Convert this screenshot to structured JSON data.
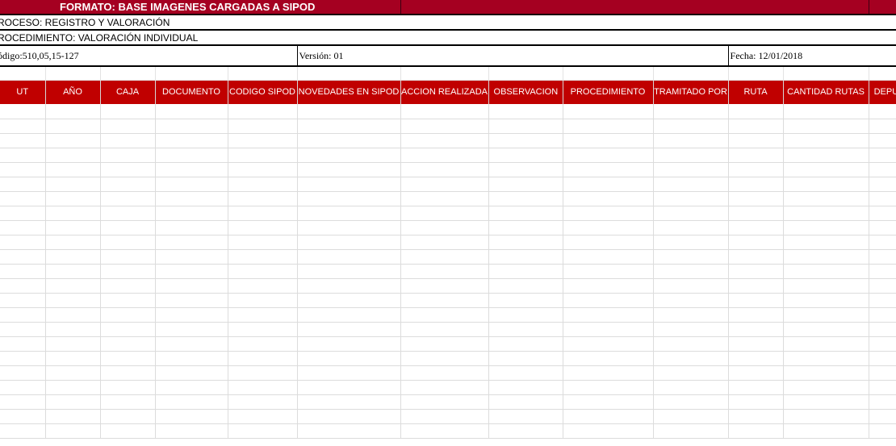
{
  "title": "FORMATO: BASE IMAGENES CARGADAS A SIPOD",
  "info": {
    "proceso": "ROCESO:  REGISTRO Y VALORACIÓN",
    "procedimiento": "ROCEDIMIENTO: VALORACIÓN INDIVIDUAL",
    "codigo": "ódigo:510,05,15-127",
    "version": "Versión: 01",
    "fecha": "Fecha:  12/01/2018"
  },
  "columns": [
    "UT",
    "AÑO",
    "CAJA",
    "DOCUMENTO",
    "CODIGO SIPOD",
    "NOVEDADES EN SIPOD",
    "ACCION REALIZADA",
    "OBSERVACION",
    "PROCEDIMIENTO",
    "TRAMITADO POR",
    "RUTA",
    "CANTIDAD RUTAS",
    "DEPU"
  ],
  "colors": {
    "title_bg": "#a50021",
    "header_bg": "#c00000",
    "gridline": "#dcdcdc"
  }
}
